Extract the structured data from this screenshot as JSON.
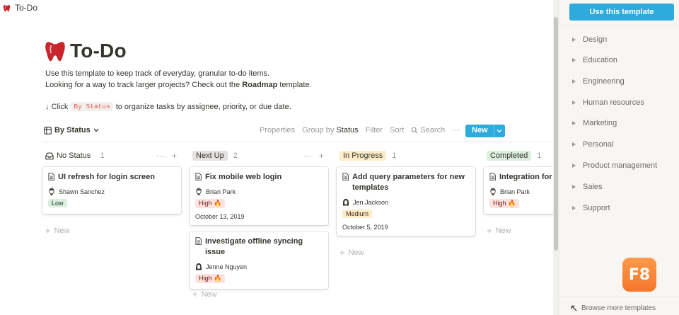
{
  "tab": {
    "title": "To-Do"
  },
  "page": {
    "title": "To-Do",
    "description_line1": "Use this template to keep track of everyday, granular to-do items.",
    "description_line2_prefix": "Looking for a way to track larger projects? Check out the ",
    "description_line2_bold": "Roadmap",
    "description_line2_suffix": " template.",
    "hint_prefix": "↓ Click",
    "hint_code": "By Status",
    "hint_suffix": "to organize tasks by assignee, priority, or due date."
  },
  "toolbar": {
    "view_label": "By Status",
    "properties": "Properties",
    "group_by": "Group by",
    "group_by_value": "Status",
    "filter": "Filter",
    "sort": "Sort",
    "search": "Search",
    "more": "···",
    "new": "New"
  },
  "columns": [
    {
      "name": "No Status",
      "count": "1",
      "pill_bg": "",
      "cards": [
        {
          "title": "UI refresh for login screen",
          "person": "Shawn Sanchez",
          "tag": "Low",
          "date": ""
        }
      ]
    },
    {
      "name": "Next Up",
      "count": "2",
      "pill_bg": "#e3e2e0",
      "cards": [
        {
          "title": "Fix mobile web login",
          "person": "Brian Park",
          "tag": "High 🔥",
          "date": "October 13, 2019"
        },
        {
          "title": "Investigate offline syncing issue",
          "person": "Jenne Nguyen",
          "tag": "High 🔥",
          "date": ""
        }
      ]
    },
    {
      "name": "In Progress",
      "count": "1",
      "pill_bg": "#fdecc8",
      "cards": [
        {
          "title": "Add query parameters for new templates",
          "person": "Jen Jackson",
          "tag": "Medium",
          "date": "October 5, 2019"
        }
      ]
    },
    {
      "name": "Completed",
      "count": "1",
      "pill_bg": "#dbeddb",
      "cards": [
        {
          "title": "Integration for S",
          "person": "Brian Park",
          "tag": "High 🔥",
          "date": ""
        }
      ]
    }
  ],
  "add_new_label": "New",
  "column_actions": {
    "more": "···",
    "add": "+"
  },
  "sidebar": {
    "use_template": "Use this template",
    "categories": [
      "Design",
      "Education",
      "Engineering",
      "Human resources",
      "Marketing",
      "Personal",
      "Product management",
      "Sales",
      "Support"
    ],
    "browse_more": "Browse more templates"
  },
  "badge": {
    "text": "F8"
  },
  "colors": {
    "accent": "#2eaadc",
    "tag_high": "#ffe2dd",
    "tag_low": "#dbeddb",
    "tag_medium": "#fdecc8"
  }
}
